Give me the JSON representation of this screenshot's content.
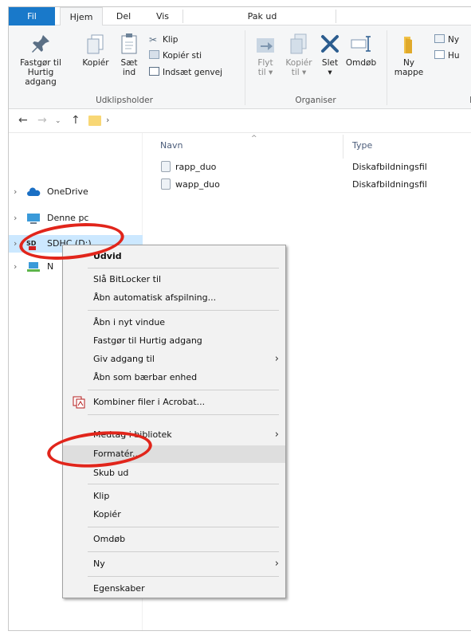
{
  "tabs": {
    "fil": "Fil",
    "hjem": "Hjem",
    "del": "Del",
    "vis": "Vis",
    "pak_ud": "Pak ud"
  },
  "ribbon": {
    "pin_line1": "Fastgør til",
    "pin_line2": "Hurtig adgang",
    "copy": "Kopiér",
    "paste_line1": "Sæt",
    "paste_line2": "ind",
    "cut": "Klip",
    "copy_path": "Kopiér sti",
    "paste_shortcut": "Indsæt genvej",
    "group_clipboard": "Udklipsholder",
    "move_line1": "Flyt",
    "move_line2": "til",
    "copyto_line1": "Kopiér",
    "copyto_line2": "til",
    "delete": "Slet",
    "rename": "Omdøb",
    "group_organize": "Organiser",
    "newfolder_line1": "Ny",
    "newfolder_line2": "mappe",
    "new_item_partial": "Ny",
    "easy_access_partial": "Hu",
    "group_new_partial": "N"
  },
  "nav_tree": [
    {
      "label": "OneDrive"
    },
    {
      "label": "Denne pc"
    },
    {
      "label": "SDHC (D:)"
    },
    {
      "label": "N"
    }
  ],
  "columns": {
    "name": "Navn",
    "type": "Type"
  },
  "files": [
    {
      "name": "rapp_duo",
      "type": "Diskafbildningsfil"
    },
    {
      "name": "wapp_duo",
      "type": "Diskafbildningsfil"
    }
  ],
  "context_menu": {
    "expand": "Udvid",
    "bitlocker": "Slå BitLocker til",
    "autoplay": "Åbn automatisk afspilning...",
    "open_new_window": "Åbn i nyt vindue",
    "pin_quick": "Fastgør til Hurtig adgang",
    "give_access": "Giv adgang til",
    "open_portable": "Åbn som bærbar enhed",
    "acrobat": "Kombiner filer i Acrobat...",
    "library": "Medtag i bibliotek",
    "format": "Formatér...",
    "eject": "Skub ud",
    "cut": "Klip",
    "copy": "Kopiér",
    "rename": "Omdøb",
    "new": "Ny",
    "properties": "Egenskaber"
  },
  "colors": {
    "accent": "#1979ca",
    "selection": "#cce8ff",
    "annotation": "#e1251b"
  }
}
